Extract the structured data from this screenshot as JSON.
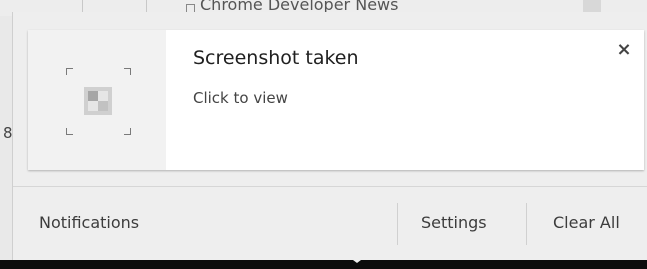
{
  "background": {
    "page_title": "Chrome Developer News",
    "side_mark": "8"
  },
  "notification": {
    "title": "Screenshot taken",
    "message": "Click to view",
    "icon": "screenshot-icon",
    "close_label": "×"
  },
  "footer": {
    "label": "Notifications",
    "settings_label": "Settings",
    "clear_all_label": "Clear All"
  }
}
